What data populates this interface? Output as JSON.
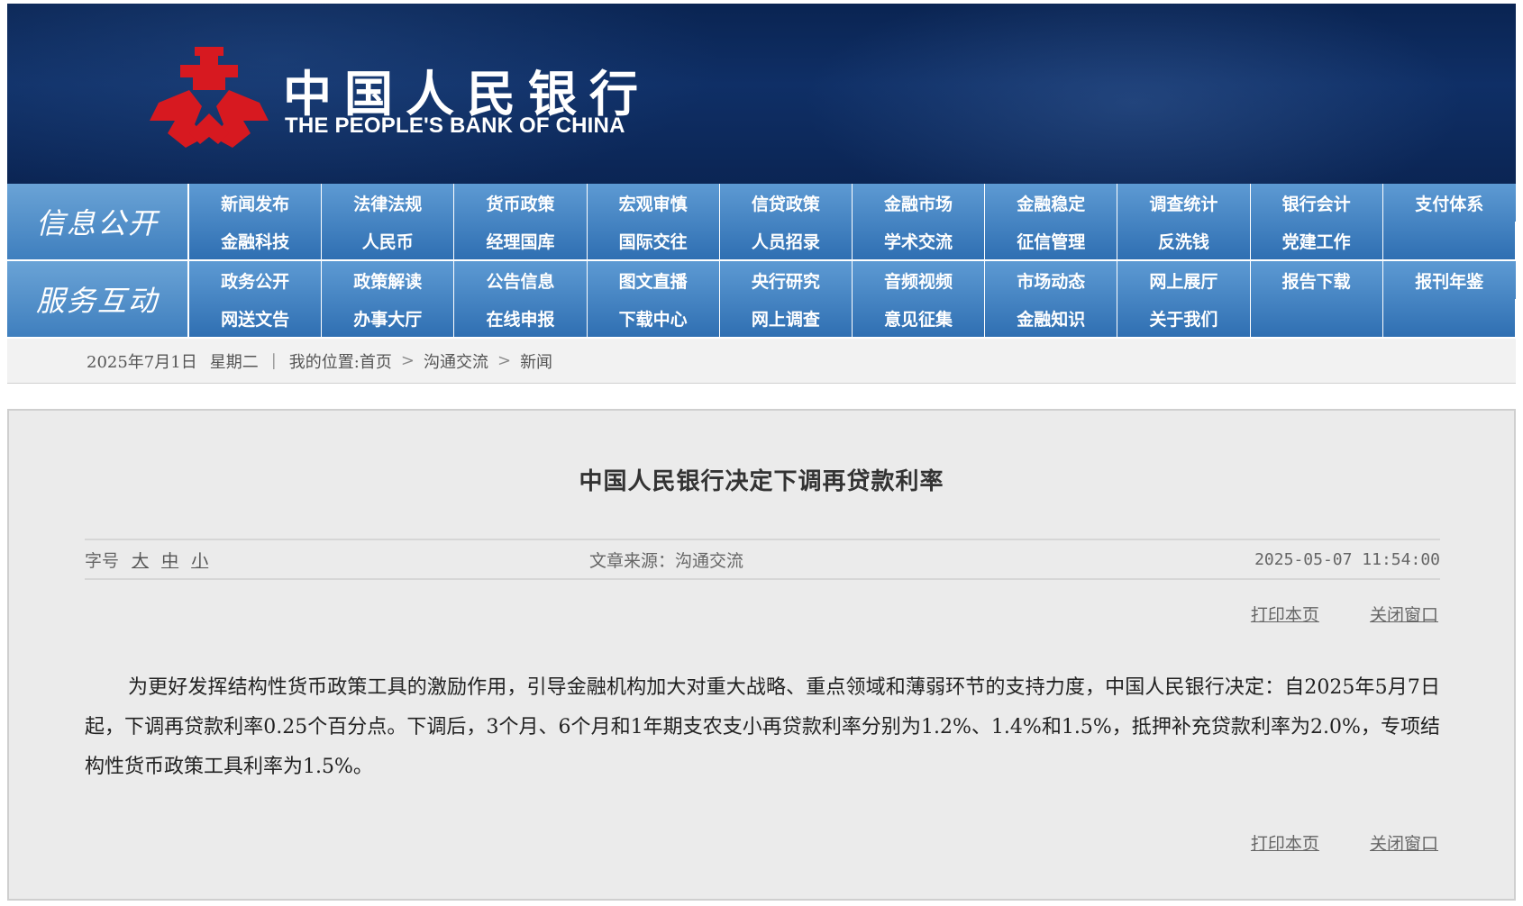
{
  "header": {
    "cn_name": "中国人民银行",
    "en_name": "THE PEOPLE'S BANK OF CHINA",
    "logo_icon": "pboc-logo-icon",
    "logo_color": "#d71920"
  },
  "nav": {
    "info": {
      "title": "信息公开",
      "row1": [
        "新闻发布",
        "法律法规",
        "货币政策",
        "宏观审慎",
        "信贷政策",
        "金融市场",
        "金融稳定",
        "调查统计",
        "银行会计",
        "支付体系"
      ],
      "row2": [
        "金融科技",
        "人民币",
        "经理国库",
        "国际交往",
        "人员招录",
        "学术交流",
        "征信管理",
        "反洗钱",
        "党建工作",
        ""
      ]
    },
    "service": {
      "title": "服务互动",
      "row1": [
        "政务公开",
        "政策解读",
        "公告信息",
        "图文直播",
        "央行研究",
        "音频视频",
        "市场动态",
        "网上展厅",
        "报告下载",
        "报刊年鉴"
      ],
      "row2": [
        "网送文告",
        "办事大厅",
        "在线申报",
        "下载中心",
        "网上调查",
        "意见征集",
        "金融知识",
        "关于我们",
        "",
        ""
      ]
    }
  },
  "breadcrumb": {
    "date": "2025年7月1日",
    "weekday": "星期二",
    "location_label": "我的位置:首页",
    "level1": "沟通交流",
    "level2": "新闻"
  },
  "article": {
    "title": "中国人民银行决定下调再贷款利率",
    "font_size_label": "字号",
    "font_large": "大",
    "font_medium": "中",
    "font_small": "小",
    "source": "文章来源：沟通交流",
    "datetime": "2025-05-07 11:54:00",
    "print_label": "打印本页",
    "close_label": "关闭窗口",
    "body": "为更好发挥结构性货币政策工具的激励作用，引导金融机构加大对重大战略、重点领域和薄弱环节的支持力度，中国人民银行决定：自2025年5月7日起，下调再贷款利率0.25个百分点。下调后，3个月、6个月和1年期支农支小再贷款利率分别为1.2%、1.4%和1.5%，抵押补充贷款利率为2.0%，专项结构性货币政策工具利率为1.5%。"
  }
}
